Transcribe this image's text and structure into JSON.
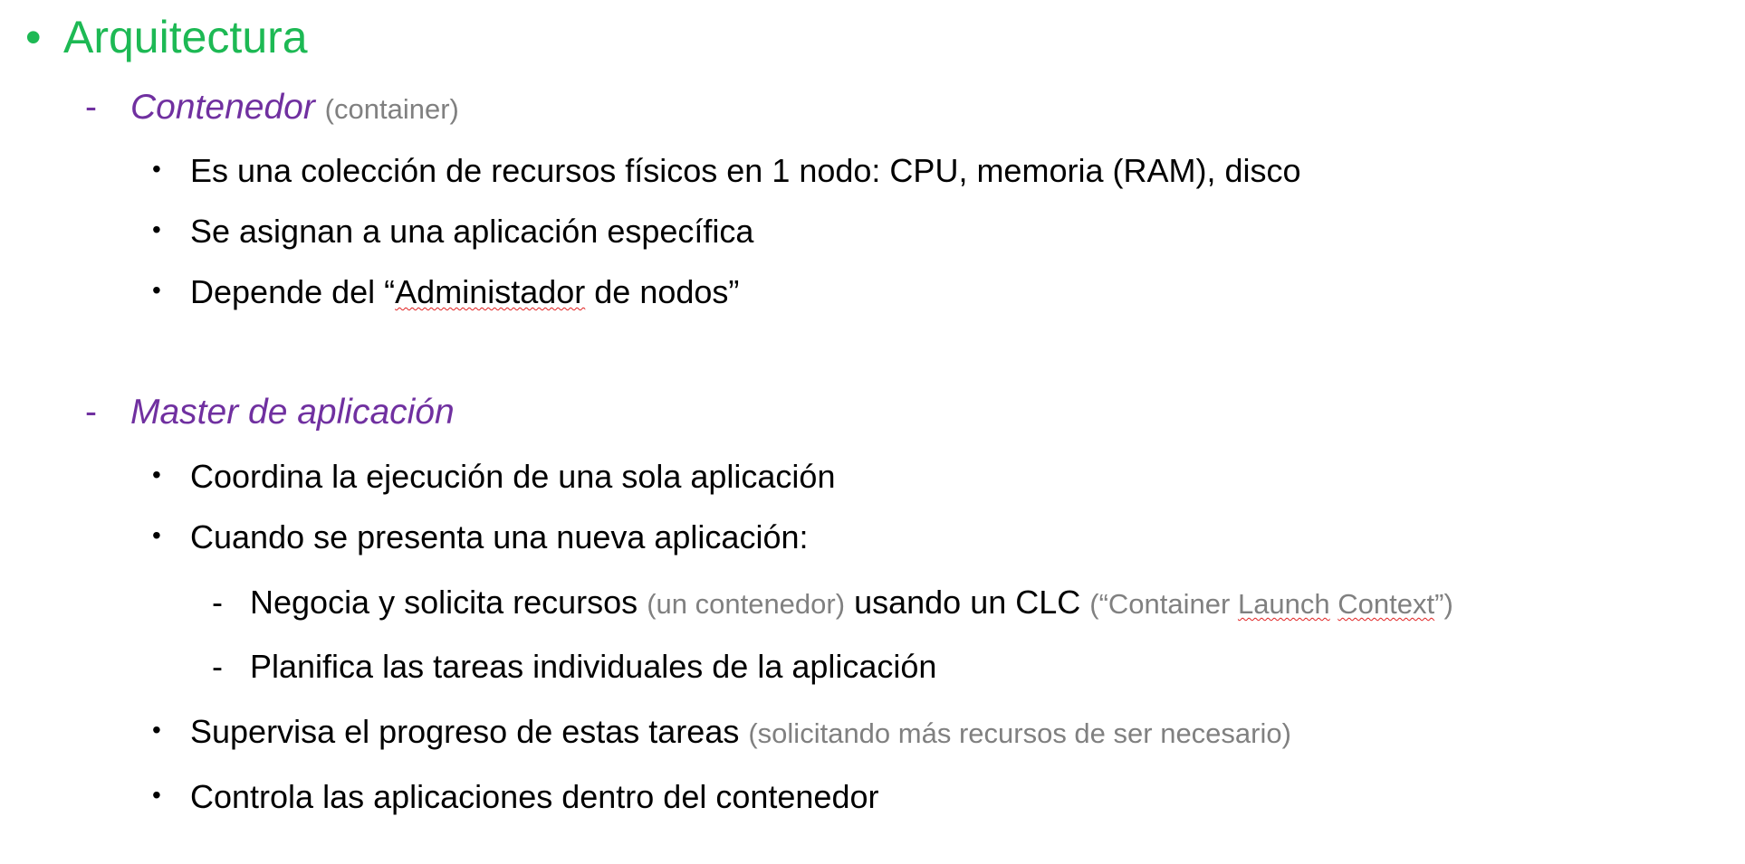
{
  "bullet_dot": "•",
  "dash": "-",
  "heading": {
    "text": "Arquitectura",
    "accent_color": "#1db954"
  },
  "sections": [
    {
      "title": "Contenedor",
      "title_note": "(container)",
      "items": [
        {
          "text": "Es una colección de recursos físicos en 1 nodo: CPU, memoria (RAM), disco"
        },
        {
          "text": "Se asignan a una aplicación específica"
        },
        {
          "before": "Depende del “",
          "marked": "Administador",
          "after": " de nodos”"
        }
      ]
    },
    {
      "title": "Master de aplicación",
      "items": [
        {
          "text": "Coordina la ejecución de una sola aplicación"
        },
        {
          "text": "Cuando se presenta una nueva aplicación:",
          "subitems": [
            {
              "text": "Negocia y solicita recursos",
              "note": "(un contenedor)",
              "text2": "usando un CLC",
              "note2_before": "(“Container ",
              "note2_mark1": "Launch",
              "note2_mark2": "Context",
              "note2_after": "”)"
            },
            {
              "text": "Planifica las tareas individuales de la aplicación"
            }
          ]
        },
        {
          "text": "Supervisa el progreso de estas tareas",
          "note": "(solicitando más recursos de ser necesario)"
        },
        {
          "text": "Controla las aplicaciones dentro del contenedor"
        }
      ]
    }
  ],
  "colors": {
    "subtitle": "#7030a0",
    "body": "#000000",
    "note": "#808080",
    "spellcheck": "#e02020"
  }
}
